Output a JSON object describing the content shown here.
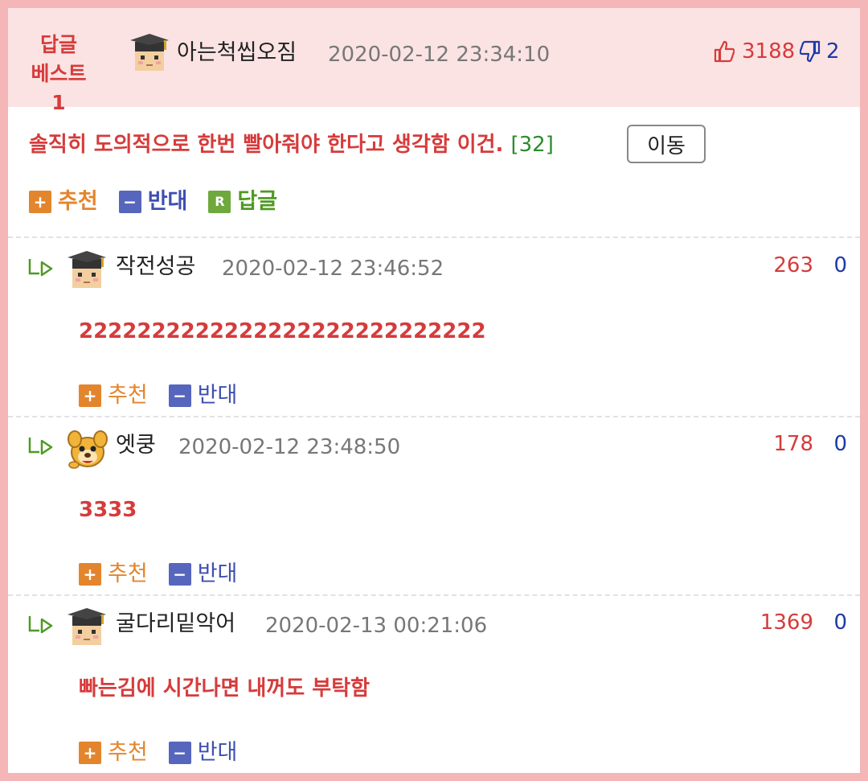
{
  "best": {
    "badge_line1": "답글",
    "badge_line2": "베스트1",
    "author": "아는척씹오짐",
    "time": "2020-02-12 23:34:10",
    "up_count": "3188",
    "down_count": "2",
    "text": "솔직히 도의적으로 한번 빨아줘야 한다고 생각함 이건.",
    "reply_count": "[32]",
    "move_label": "이동",
    "recommend_label": "추천",
    "oppose_label": "반대",
    "reply_label": "답글",
    "reply_icon_letter": "R"
  },
  "comments": [
    {
      "author": "작전성공",
      "time": "2020-02-12 23:46:52",
      "up": "263",
      "down": "0",
      "text": "2222222222222222222222222222",
      "recommend_label": "추천",
      "oppose_label": "반대",
      "avatar": "student-avatar-icon"
    },
    {
      "author": "엣쿵",
      "time": "2020-02-12 23:48:50",
      "up": "178",
      "down": "0",
      "text": "3333",
      "recommend_label": "추천",
      "oppose_label": "반대",
      "avatar": "dog-avatar-icon"
    },
    {
      "author": "굴다리밑악어",
      "time": "2020-02-13 00:21:06",
      "up": "1369",
      "down": "0",
      "text": "빠는김에 시간나면 내꺼도 부탁함",
      "recommend_label": "추천",
      "oppose_label": "반대",
      "avatar": "student-avatar-icon"
    }
  ],
  "colors": {
    "accent_red": "#d63b3b",
    "header_bg": "#fbe3e3",
    "frame_border": "#f4b6b6",
    "recommend_orange": "#e3852d",
    "oppose_blue": "#5766bd",
    "reply_green": "#6fa83d"
  }
}
